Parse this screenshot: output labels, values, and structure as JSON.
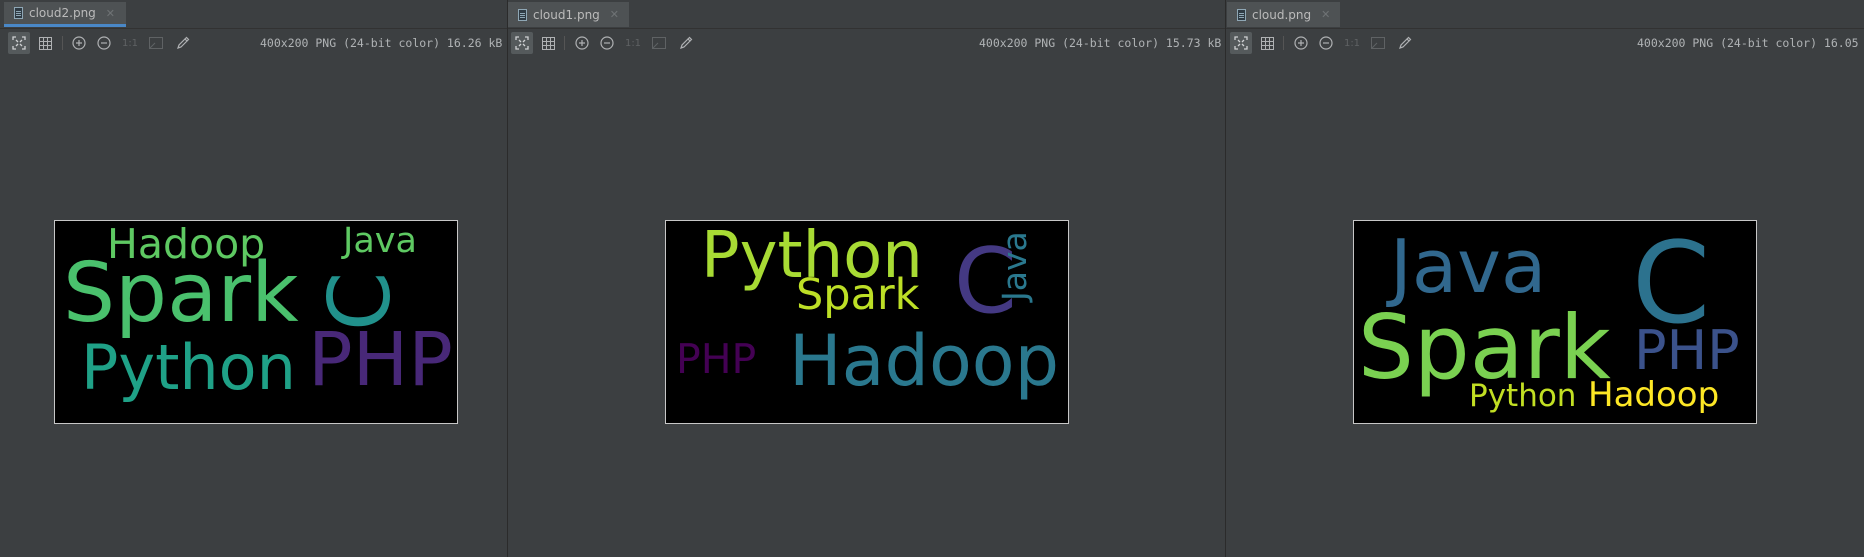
{
  "panes": [
    {
      "tab_label": "cloud2.png",
      "info": "400x200 PNG (24-bit color) 16.26 kB",
      "words": [
        {
          "text": "Hadoop",
          "color": "#5ec962"
        },
        {
          "text": "Java",
          "color": "#5ec962"
        },
        {
          "text": "Spark",
          "color": "#4ac16d"
        },
        {
          "text": "C",
          "color": "#21918c"
        },
        {
          "text": "Python",
          "color": "#1fa187"
        },
        {
          "text": "PHP",
          "color": "#482878"
        }
      ]
    },
    {
      "tab_label": "cloud1.png",
      "info": "400x200 PNG (24-bit color) 15.73 kB",
      "words": [
        {
          "text": "Python",
          "color": "#a8db34"
        },
        {
          "text": "Spark",
          "color": "#bddf26"
        },
        {
          "text": "C",
          "color": "#443983"
        },
        {
          "text": "Java",
          "color": "#2a788e"
        },
        {
          "text": "PHP",
          "color": "#440154"
        },
        {
          "text": "Hadoop",
          "color": "#2a788e"
        }
      ]
    },
    {
      "tab_label": "cloud.png",
      "info": "400x200 PNG (24-bit color) 16.05",
      "words": [
        {
          "text": "Java",
          "color": "#31688e"
        },
        {
          "text": "C",
          "color": "#2c728e"
        },
        {
          "text": "Spark",
          "color": "#7ad151"
        },
        {
          "text": "PHP",
          "color": "#3b528b"
        },
        {
          "text": "Python",
          "color": "#c2df23"
        },
        {
          "text": "Hadoop",
          "color": "#fde725"
        }
      ]
    }
  ],
  "toolbar_icons": [
    "zoom-to-fit-icon",
    "grid-icon",
    "zoom-in-icon",
    "zoom-out-icon",
    "actual-size-icon",
    "background-icon",
    "color-picker-icon"
  ],
  "actual_size_label": "1:1",
  "colors": {
    "accent": "#4a88c7",
    "panel": "#3c3f41"
  }
}
